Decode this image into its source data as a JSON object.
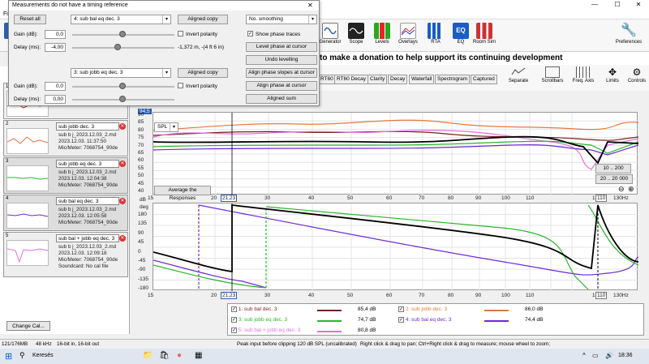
{
  "app": {
    "menu": [
      "File"
    ],
    "toolbar": [
      "Me",
      "Generator",
      "Scope",
      "Levels",
      "Overlays",
      "RTA",
      "EQ",
      "Room Sim",
      "Preferences"
    ],
    "donate_text": "to make a donation to help support its continuing development"
  },
  "graph_tabs": [
    "RT60",
    "RT60 Decay",
    "Clarity",
    "Decay",
    "Waterfall",
    "Spectrogram",
    "Captured"
  ],
  "graph_icons": [
    "Separate",
    "Scrollbars",
    "Freq. Axis",
    "Limits",
    "Controls"
  ],
  "dialog": {
    "title": "Measurements do not have a timing reference",
    "reset_all": "Reset all",
    "meas_a": "4: sub bal eq dec. 3",
    "meas_b": "3: sub jobb eq dec. 3",
    "aligned_copy": "Aligned copy",
    "gain_label": "Gain (dB):",
    "delay_label": "Delay (ms):",
    "gain_a": "0,0",
    "delay_a": "-4,00",
    "gain_b": "0,0",
    "delay_b": "0,00",
    "invert": "Invert polarity",
    "delay_text": "-1,372 m, -(4 ft 6 in)",
    "smoothing": "No. smoothing",
    "show_phase": "Show phase traces",
    "level_phase": "Level phase at cursor",
    "undo_level": "Undo levelling",
    "align_slopes": "Align phase slopes at cursor",
    "align_phase": "Align phase at cursor",
    "aligned_sum": "Aligned sum"
  },
  "measurements": [
    {
      "num": "1",
      "name": "",
      "info": "",
      "color": "#c0392b"
    },
    {
      "num": "2",
      "name": "sub jobb dec. 3",
      "info": "sub b j_2023.12.03_2.md\n2023.12.03. 11:37:50\nMic/Meter: 7068754_90de",
      "color": "#e07040"
    },
    {
      "num": "3",
      "name": "sub jobb eq dec. 3",
      "info": "sub b j_2023.12.03_2.md\n2023.12.03. 12:04:38\nMic/Meter: 7068754_90de",
      "color": "#2bb52b"
    },
    {
      "num": "4",
      "name": "sub bal eq dec. 3",
      "info": "sub b j_2023.12.03_2.md\n2023.12.03. 12:05:58\nMic/Meter: 7068754_90de",
      "color": "#6a2bd6"
    },
    {
      "num": "5",
      "name": "sub bal + jobb eq dec. 3",
      "info": "sub b j_2023.12.03_2.md\n2023.12.03. 12:09:18\nMic/Meter: 7068754_90de\nSoundcard: No cal file",
      "color": "#e070e0"
    }
  ],
  "change_cal": "Change Cal...",
  "spl_chart": {
    "selector": "SPL",
    "y_unit": "dB",
    "y_ticks": [
      "90",
      "85",
      "80",
      "75",
      "70",
      "65",
      "60",
      "55",
      "50",
      "45",
      "40"
    ],
    "cursor_value": "94,5",
    "range_btn_1": "10 .. 200",
    "range_btn_2": "20 .. 20 000",
    "avg_btn": "Average the Responses"
  },
  "phase_chart": {
    "y_unit": "deg",
    "y_ticks": [
      "180",
      "135",
      "90",
      "45",
      "0",
      "-45",
      "-90",
      "-135",
      "-180"
    ]
  },
  "x_ticks": [
    "15",
    "20",
    "30",
    "40",
    "50",
    "60",
    "70",
    "80",
    "90",
    "100",
    "110",
    "120",
    "130Hz"
  ],
  "cursor_freq": "21,23",
  "marker_freq": "110",
  "legend": [
    {
      "label": "1: sub bal dec. 3",
      "value": "85,4 dB",
      "color": "#7a1f1f"
    },
    {
      "label": "2: sub jobb dec. 3",
      "value": "86,0 dB",
      "color": "#e07a40"
    },
    {
      "label": "3: sub jobb eq dec. 3",
      "value": "74,7 dB",
      "color": "#2bb52b"
    },
    {
      "label": "4: sub bal eq dec. 3",
      "value": "74,4 dB",
      "color": "#6a2bd6"
    },
    {
      "label": "5: sub bal + jobb eq dec. 3",
      "value": "80,8 dB",
      "color": "#e070e0"
    }
  ],
  "status": {
    "mem": "121/176MB",
    "rate": "48 kHz",
    "bits": "16-bit in, 16-bit out",
    "peak": "Peak input before clipping 120 dB SPL (uncalibrated)",
    "hint": "Right click & drag to pan; Ctrl+Right click & drag to measure; mouse wheel to zoom;"
  },
  "taskbar": {
    "search": "Keresés",
    "time": "18:36"
  }
}
